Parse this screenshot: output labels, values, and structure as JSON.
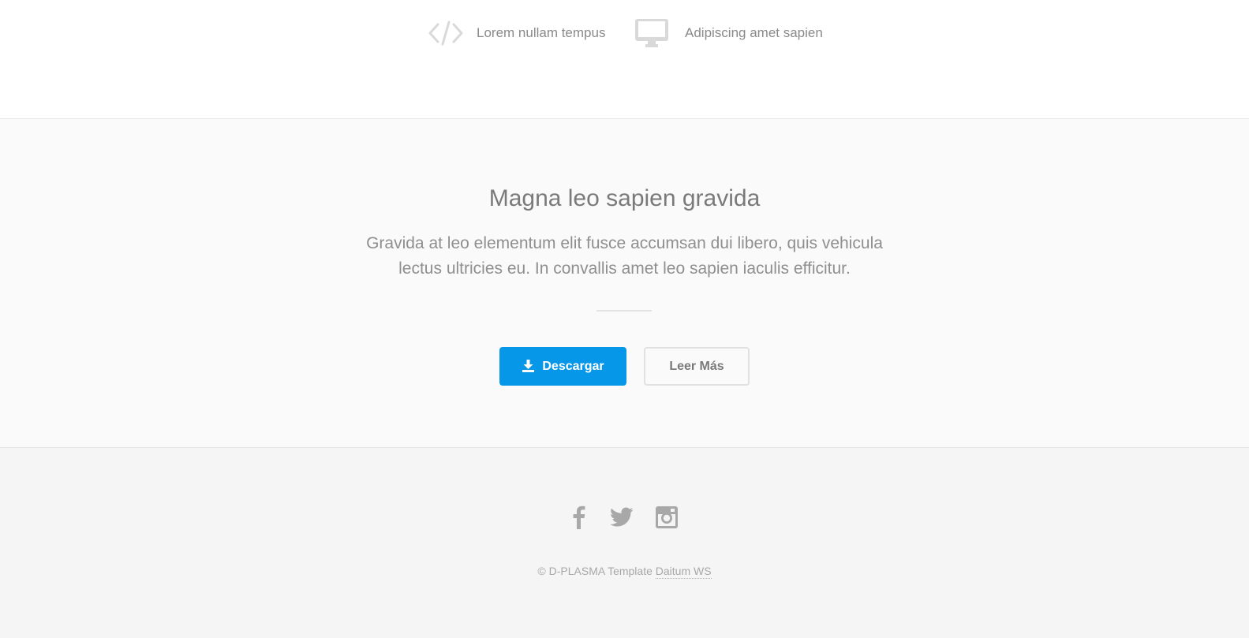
{
  "features": [
    {
      "icon": "code-icon",
      "label": "Lorem nullam tempus"
    },
    {
      "icon": "desktop-icon",
      "label": "Adipiscing amet sapien"
    }
  ],
  "cta": {
    "title": "Magna leo sapien gravida",
    "text": "Gravida at leo elementum elit fusce accumsan dui libero, quis vehicula lectus ultricies eu. In convallis amet leo sapien iaculis efficitur.",
    "primary_button": {
      "label": "Descargar",
      "icon": "download-icon",
      "color": "#0797e9"
    },
    "secondary_button": {
      "label": "Leer Más"
    }
  },
  "footer": {
    "social": [
      {
        "icon": "facebook-icon"
      },
      {
        "icon": "twitter-icon"
      },
      {
        "icon": "instagram-icon"
      }
    ],
    "copyright_prefix": "© D-PLASMA Template",
    "copyright_link": "Daitum WS"
  }
}
